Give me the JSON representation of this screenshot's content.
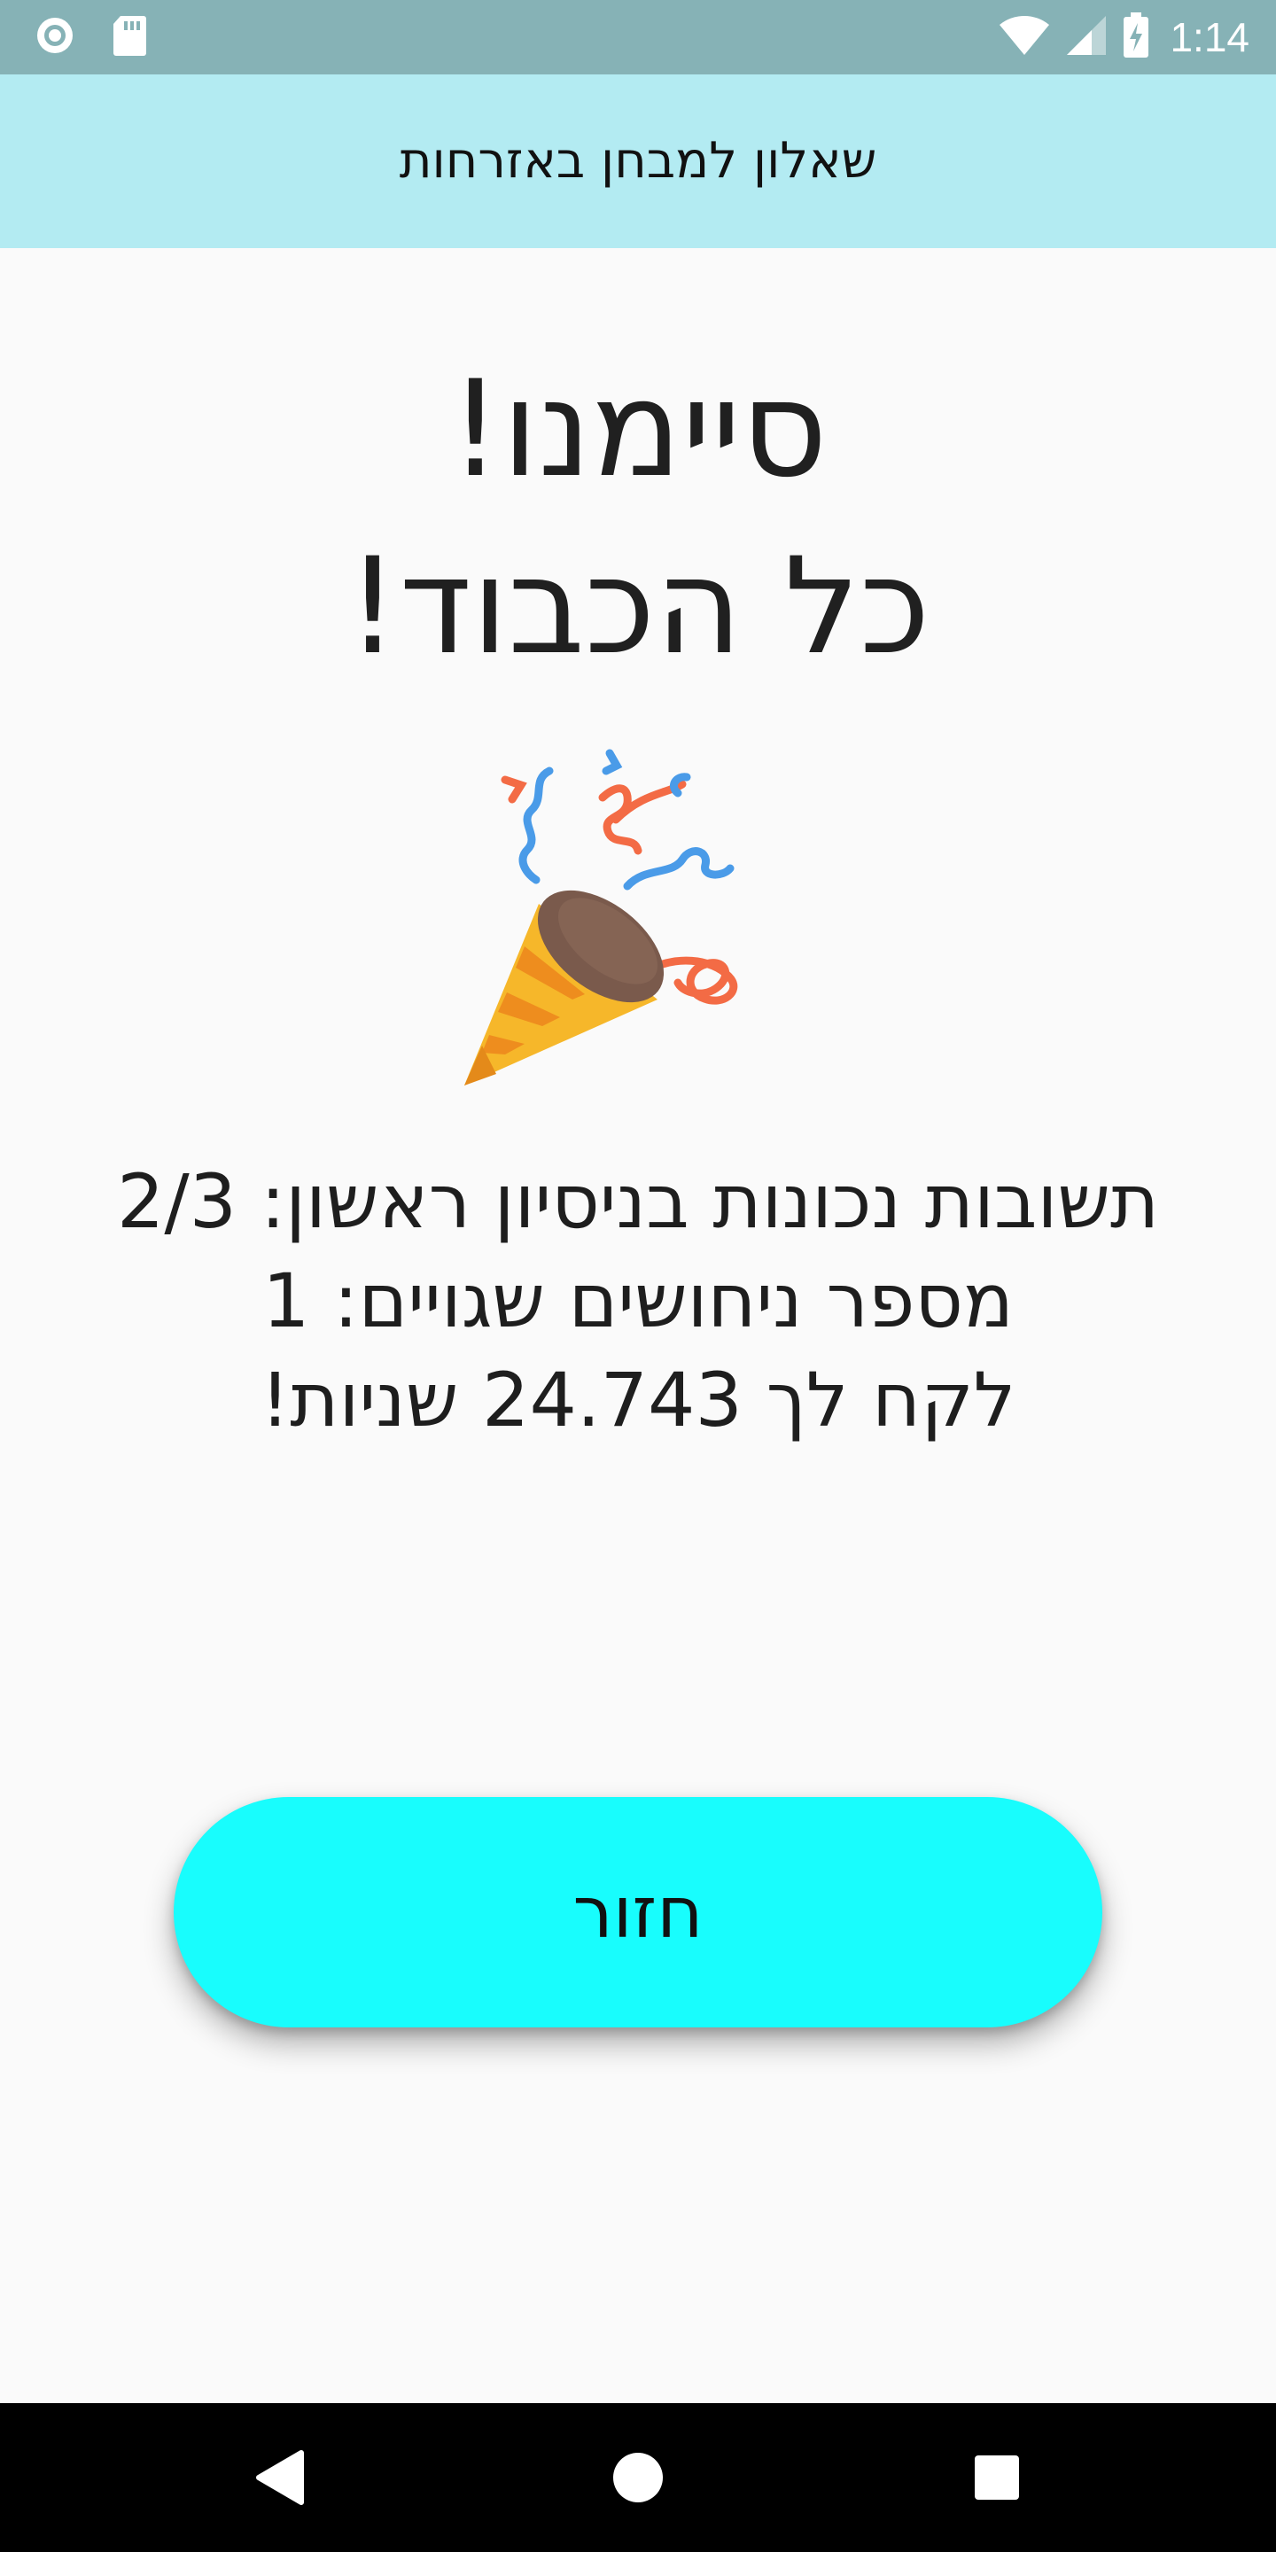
{
  "status_bar": {
    "time": "1:14",
    "icons": [
      "sync-icon",
      "sd-card-icon",
      "wifi-icon",
      "signal-icon",
      "battery-charging-icon"
    ]
  },
  "toolbar": {
    "title": "שאלון למבחן באזרחות"
  },
  "headline": {
    "line1": "סיימנו!",
    "line2": "כל הכבוד!"
  },
  "celebration_icon": "party-popper-icon",
  "stats": {
    "first_try_correct": "תשובות נכונות בניסיון ראשון: 2/3",
    "wrong_guesses": "מספר ניחושים שגויים: 1",
    "time_taken": "לקח לך 24.743 שניות!"
  },
  "back_button": {
    "label": "חזור"
  },
  "nav_bar": {
    "icons": [
      "back-triangle-icon",
      "home-circle-icon",
      "recents-square-icon"
    ]
  },
  "colors": {
    "status_bar": "#86b2b6",
    "toolbar": "#b3ebf2",
    "background": "#fafafa",
    "button": "#18fdfd",
    "nav_bar": "#000000"
  }
}
